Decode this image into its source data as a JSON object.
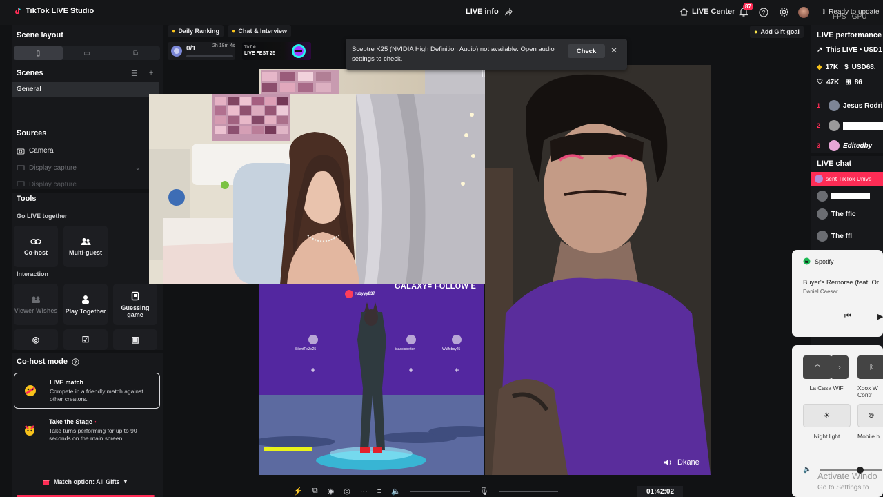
{
  "app": {
    "title": "TikTok LIVE Studio",
    "live_info": "LIVE info",
    "live_center": "LIVE Center",
    "notifications_count": "87",
    "ready_to_update": "Ready to update",
    "fps": "FPS",
    "gpu": "GPU"
  },
  "left": {
    "scene_layout_title": "Scene layout",
    "scenes_title": "Scenes",
    "scenes": [
      "General"
    ],
    "sources_title": "Sources",
    "sources": [
      "Camera",
      "Display capture",
      "Display capture"
    ],
    "tools_title": "Tools",
    "go_live_together": "Go LIVE together",
    "cohost": "Co-host",
    "multiguest": "Multi-guest",
    "interaction": "Interaction",
    "viewer_wishes": "Viewer Wishes",
    "play_together": "Play Together",
    "guessing_game": "Guessing game",
    "cohost_mode_title": "Co-host mode",
    "live_match_title": "LIVE match",
    "live_match_desc": "Compete in a friendly match against other creators.",
    "take_stage_title": "Take the Stage",
    "take_stage_desc": "Take turns performing for up to 90 seconds on the main screen.",
    "match_option": "Match option: All Gifts"
  },
  "stage": {
    "daily_ranking": "Daily Ranking",
    "chat_interview": "Chat & Interview",
    "rank_value": "0/1",
    "rank_timer": "2h 18m 4s",
    "fest_brand": "TikTok",
    "fest_title": "LIVE FEST 25",
    "add_gift_goal": "Add Gift goal",
    "toast_message": "Sceptre K25 (NVIDIA High Definition Audio) not available. Open audio settings to check.",
    "toast_check": "Check",
    "banner_text": "GALAXY= FOLLOW E",
    "streamer_handle": "rubyyy837",
    "players": [
      "SilentRoZe25",
      "isaacisbetter",
      "Wulfoboy25"
    ],
    "guest_name": "Dkane",
    "timer": "01:42:02"
  },
  "right": {
    "live_performance": "LIVE performance",
    "this_live": "This LIVE • USD1",
    "diamonds": "17K",
    "usd": "USD68.",
    "likes": "47K",
    "gifters": "86",
    "ranks": [
      {
        "num": "1",
        "name": "Jesus Rodri"
      },
      {
        "num": "2",
        "name": ""
      },
      {
        "num": "3",
        "name": "Editedby"
      }
    ],
    "live_chat": "LIVE chat",
    "chat_gift": "sent TikTok Unive",
    "chat_rows": [
      "The ffic",
      "The ffl"
    ]
  },
  "spotify": {
    "app_name": "Spotify",
    "track": "Buyer's Remorse (feat. Or",
    "artist": "Daniel Caesar"
  },
  "quick": {
    "wifi_label": "La Casa WiFi",
    "bt_label": "Xbox W Contr",
    "night_light": "Night light",
    "mobile": "Mobile h"
  },
  "windows": {
    "activate": "Activate Windo",
    "go_settings": "Go to Settings to"
  }
}
